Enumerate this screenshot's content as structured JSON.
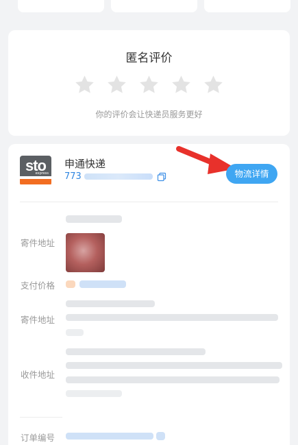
{
  "rating": {
    "title": "匿名评价",
    "stars": 5,
    "hint": "你的评价会让快递员服务更好"
  },
  "shipment": {
    "company": "申通快递",
    "logo_text": "sto",
    "logo_sub": "express",
    "tracking_prefix": "773",
    "details_button": "物流详情"
  },
  "fields": {
    "sender_address_label_1": "寄件地址",
    "payment_price_label": "支付价格",
    "sender_address_label_2": "寄件地址",
    "recipient_address_label": "收件地址",
    "order_number_label": "订单编号"
  },
  "colors": {
    "accent_blue": "#3fa6f2",
    "brand_orange": "#f26d21",
    "arrow_red": "#e8312b"
  }
}
